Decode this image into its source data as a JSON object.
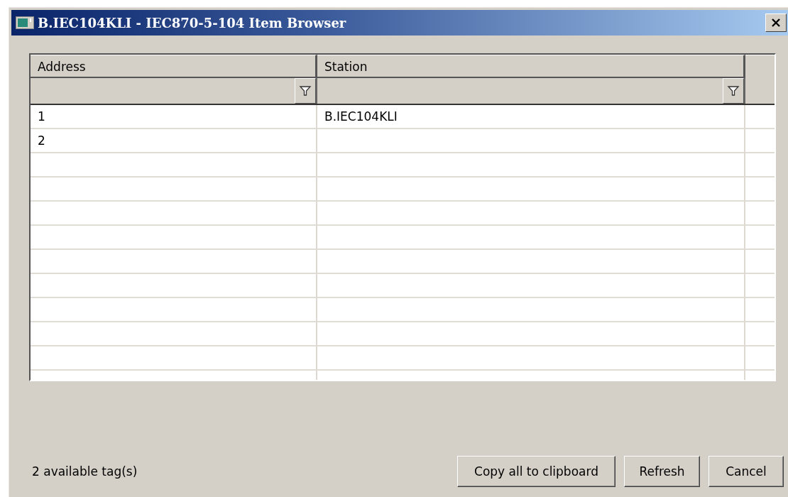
{
  "window": {
    "title": "B.IEC104KLI - IEC870-5-104 Item Browser"
  },
  "table": {
    "columns": [
      {
        "label": "Address",
        "filter": true
      },
      {
        "label": "Station",
        "filter": true
      }
    ],
    "rows": [
      {
        "address": "1",
        "station": "B.IEC104KLI"
      },
      {
        "address": "2"
      }
    ]
  },
  "status_text": "2 available tag(s)",
  "buttons": [
    "Copy all to clipboard",
    "Refresh",
    "Cancel"
  ]
}
